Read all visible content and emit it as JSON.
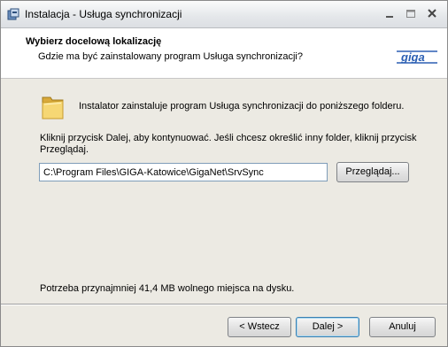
{
  "window": {
    "title": "Instalacja - Usługa synchronizacji"
  },
  "header": {
    "title": "Wybierz docelową lokalizację",
    "subtitle": "Gdzie ma być zainstalowany program Usługa synchronizacji?",
    "logo_text": "giga"
  },
  "content": {
    "info": "Instalator zainstaluje program Usługa synchronizacji do poniższego folderu.",
    "instruction": "Kliknij przycisk Dalej, aby kontynuować. Jeśli chcesz określić inny folder, kliknij przycisk Przeglądaj.",
    "path_value": "C:\\Program Files\\GIGA-Katowice\\GigaNet\\SrvSync",
    "browse_label": "Przeglądaj...",
    "space_required": "Potrzeba przynajmniej 41,4 MB wolnego miejsca na dysku."
  },
  "footer": {
    "back_label": "< Wstecz",
    "next_label": "Dalej >",
    "cancel_label": "Anuluj"
  },
  "icons": {
    "app": "installer-icon",
    "folder": "folder-icon",
    "minimize": "minimize-icon",
    "maximize": "maximize-icon",
    "close": "close-icon"
  },
  "colors": {
    "logo": "#2b5fb3",
    "dialog_bg": "#eceae3",
    "header_bg": "#ffffff"
  }
}
